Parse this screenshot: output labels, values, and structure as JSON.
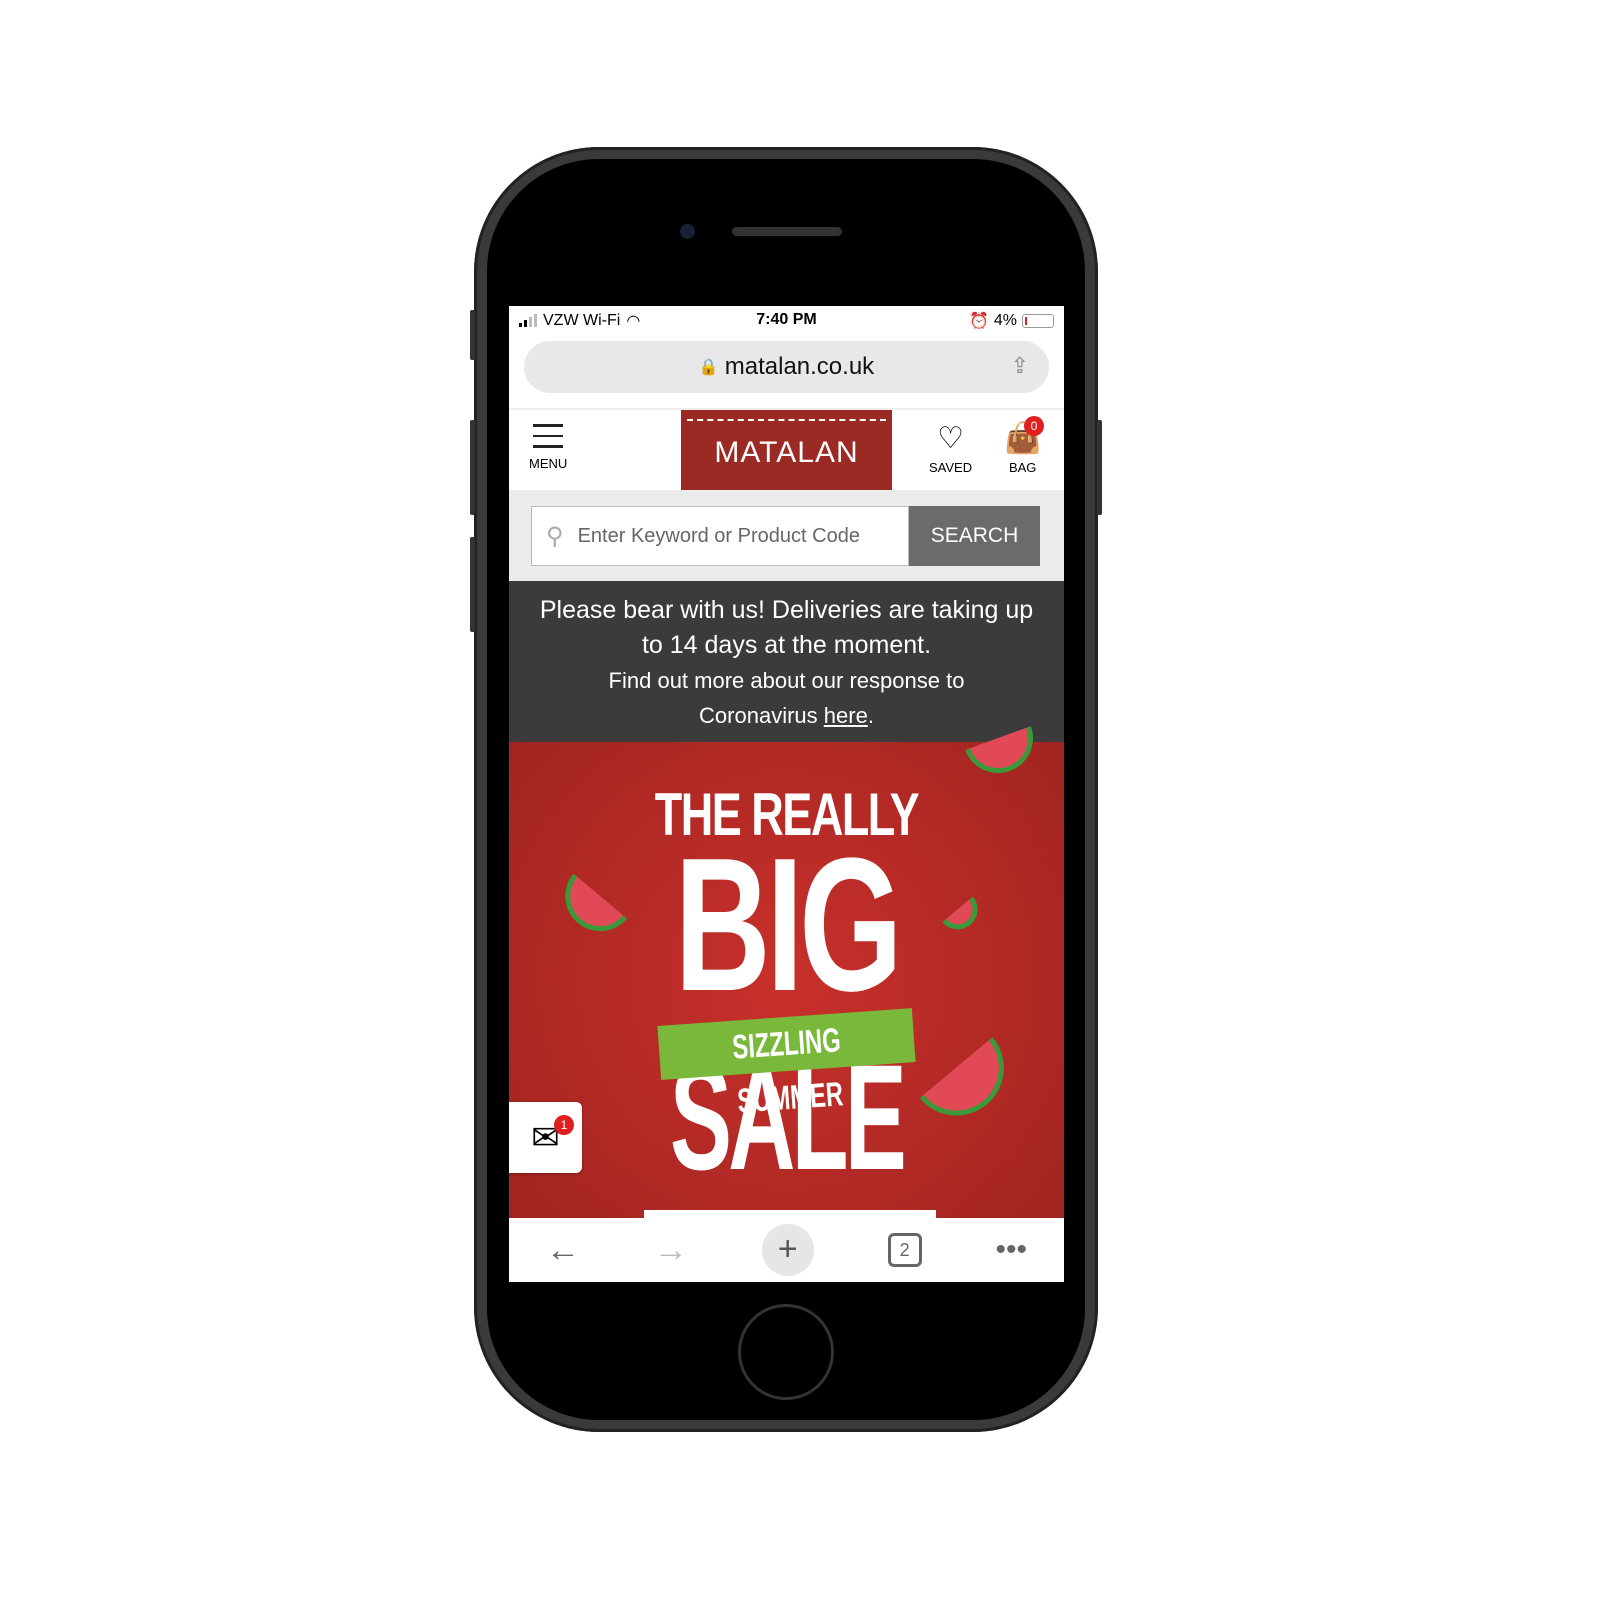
{
  "status": {
    "carrier": "VZW Wi-Fi",
    "time": "7:40 PM",
    "battery": "4%"
  },
  "browser": {
    "url": "matalan.co.uk",
    "tab_count": "2"
  },
  "header": {
    "menu": "MENU",
    "logo": "MATALAN",
    "saved": "SAVED",
    "bag": "BAG",
    "bag_count": "0"
  },
  "search": {
    "placeholder": "Enter Keyword or Product Code",
    "button": "SEARCH"
  },
  "notice": {
    "line1": "Please bear with us! Deliveries are taking up to 14 days at the moment.",
    "line2": "Find out more about our response to Coronavirus ",
    "link": "here",
    "end": "."
  },
  "banner": {
    "title1": "THE REALLY",
    "title2": "BIG",
    "tag": "SIZZLING SUMMER",
    "title3": "SALE",
    "colors": {
      "bg": "#b32a25",
      "tag": "#7ab83b"
    }
  },
  "mail": {
    "count": "1"
  }
}
